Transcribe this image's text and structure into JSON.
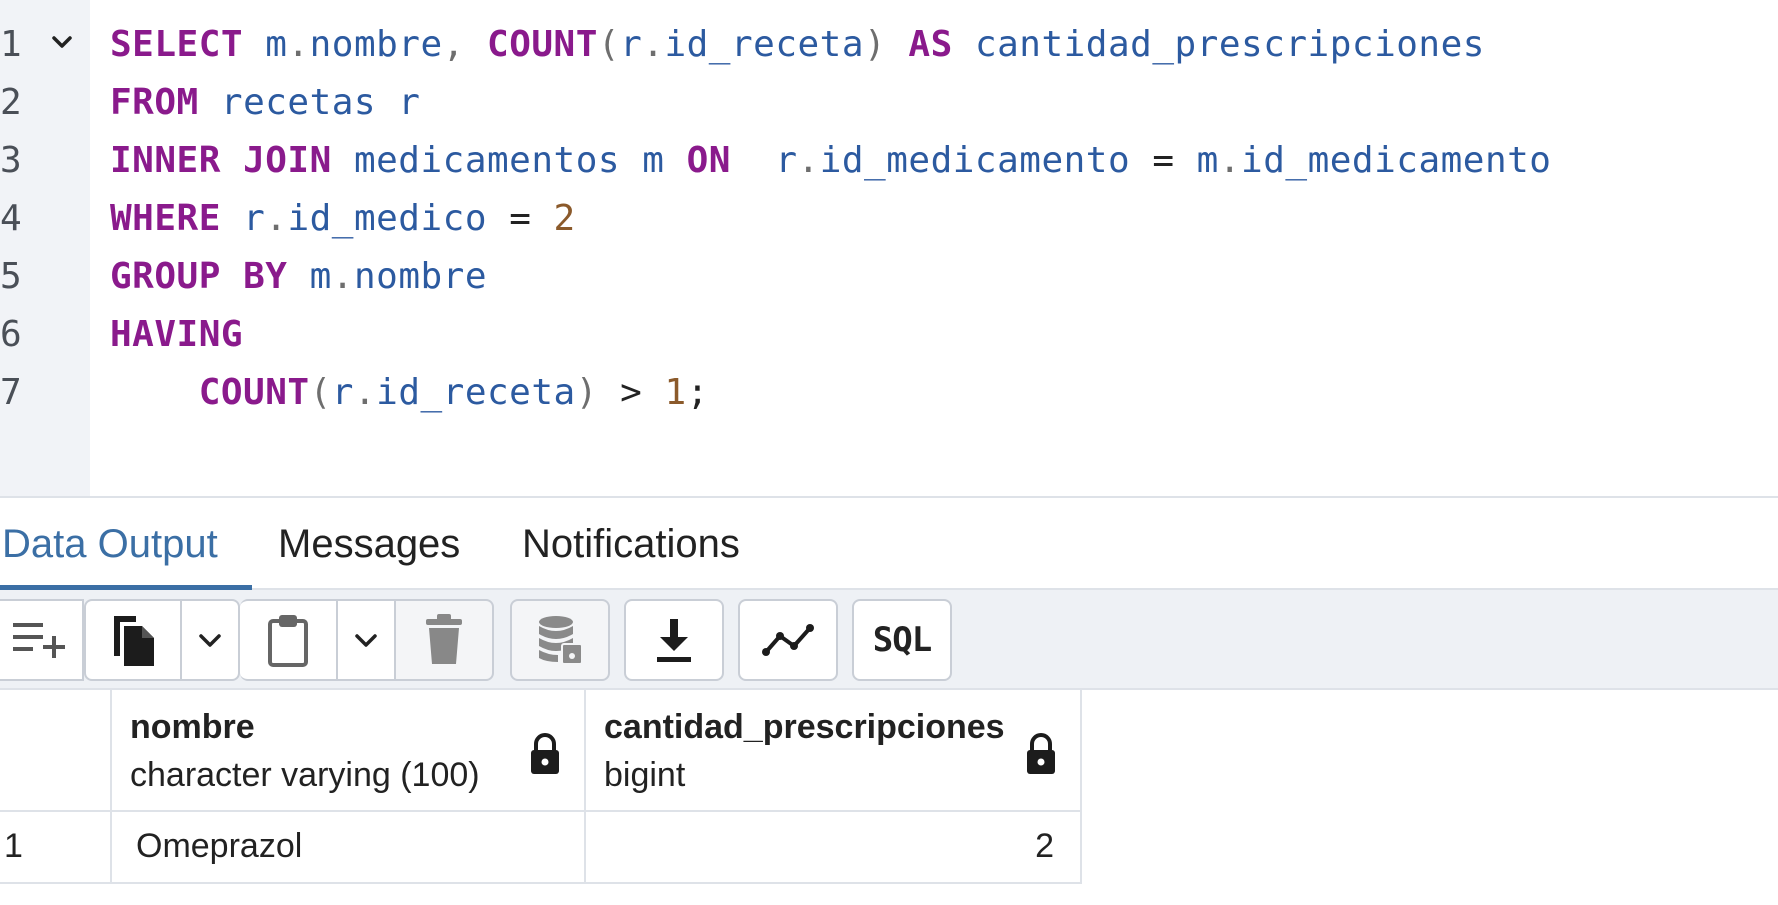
{
  "editor": {
    "line_numbers": [
      "1",
      "2",
      "3",
      "4",
      "5",
      "6",
      "7"
    ],
    "lines": [
      [
        {
          "t": "SELECT",
          "c": "kw"
        },
        {
          "t": " ",
          "c": "op"
        },
        {
          "t": "m",
          "c": "id"
        },
        {
          "t": ".",
          "c": "pn"
        },
        {
          "t": "nombre",
          "c": "id"
        },
        {
          "t": ", ",
          "c": "pn"
        },
        {
          "t": "COUNT",
          "c": "kw"
        },
        {
          "t": "(",
          "c": "pn"
        },
        {
          "t": "r",
          "c": "id"
        },
        {
          "t": ".",
          "c": "pn"
        },
        {
          "t": "id_receta",
          "c": "id"
        },
        {
          "t": ") ",
          "c": "pn"
        },
        {
          "t": "AS",
          "c": "kw"
        },
        {
          "t": " ",
          "c": "op"
        },
        {
          "t": "cantidad_prescripciones",
          "c": "id"
        }
      ],
      [
        {
          "t": "FROM",
          "c": "kw"
        },
        {
          "t": " ",
          "c": "op"
        },
        {
          "t": "recetas",
          "c": "id"
        },
        {
          "t": " ",
          "c": "op"
        },
        {
          "t": "r",
          "c": "id"
        }
      ],
      [
        {
          "t": "INNER",
          "c": "kw"
        },
        {
          "t": " ",
          "c": "op"
        },
        {
          "t": "JOIN",
          "c": "kw"
        },
        {
          "t": " ",
          "c": "op"
        },
        {
          "t": "medicamentos",
          "c": "id"
        },
        {
          "t": " ",
          "c": "op"
        },
        {
          "t": "m",
          "c": "id"
        },
        {
          "t": " ",
          "c": "op"
        },
        {
          "t": "ON",
          "c": "kw"
        },
        {
          "t": "  ",
          "c": "op"
        },
        {
          "t": "r",
          "c": "id"
        },
        {
          "t": ".",
          "c": "pn"
        },
        {
          "t": "id_medicamento",
          "c": "id"
        },
        {
          "t": " = ",
          "c": "op"
        },
        {
          "t": "m",
          "c": "id"
        },
        {
          "t": ".",
          "c": "pn"
        },
        {
          "t": "id_medicamento",
          "c": "id"
        }
      ],
      [
        {
          "t": "WHERE",
          "c": "kw"
        },
        {
          "t": " ",
          "c": "op"
        },
        {
          "t": "r",
          "c": "id"
        },
        {
          "t": ".",
          "c": "pn"
        },
        {
          "t": "id_medico",
          "c": "id"
        },
        {
          "t": " = ",
          "c": "op"
        },
        {
          "t": "2",
          "c": "num"
        }
      ],
      [
        {
          "t": "GROUP",
          "c": "kw"
        },
        {
          "t": " ",
          "c": "op"
        },
        {
          "t": "BY",
          "c": "kw"
        },
        {
          "t": " ",
          "c": "op"
        },
        {
          "t": "m",
          "c": "id"
        },
        {
          "t": ".",
          "c": "pn"
        },
        {
          "t": "nombre",
          "c": "id"
        }
      ],
      [
        {
          "t": "HAVING",
          "c": "kw"
        }
      ],
      [
        {
          "t": "    ",
          "c": "op"
        },
        {
          "t": "COUNT",
          "c": "kw"
        },
        {
          "t": "(",
          "c": "pn"
        },
        {
          "t": "r",
          "c": "id"
        },
        {
          "t": ".",
          "c": "pn"
        },
        {
          "t": "id_receta",
          "c": "id"
        },
        {
          "t": ")",
          "c": "pn"
        },
        {
          "t": " > ",
          "c": "op"
        },
        {
          "t": "1",
          "c": "num"
        },
        {
          "t": ";",
          "c": "op"
        }
      ]
    ]
  },
  "tabs": {
    "data_output": "Data Output",
    "messages": "Messages",
    "notifications": "Notifications"
  },
  "toolbar": {
    "icons": [
      "add-row-icon",
      "copy-icon",
      "chevron-down-icon",
      "paste-icon",
      "chevron-down-icon",
      "delete-icon",
      "save-data-icon",
      "download-icon",
      "graph-icon",
      "sql-icon"
    ],
    "sql_label": "SQL"
  },
  "grid": {
    "columns": [
      {
        "name": "nombre",
        "type": "character varying (100)"
      },
      {
        "name": "cantidad_prescripciones",
        "type": "bigint"
      }
    ],
    "rows": [
      {
        "row_number": "1",
        "nombre": "Omeprazol",
        "cantidad_prescripciones": "2"
      }
    ]
  },
  "colors": {
    "keyword": "#8a1a8c",
    "identifier": "#2c5aa0",
    "number": "#8b5a2b",
    "accent": "#3b6fa5"
  }
}
